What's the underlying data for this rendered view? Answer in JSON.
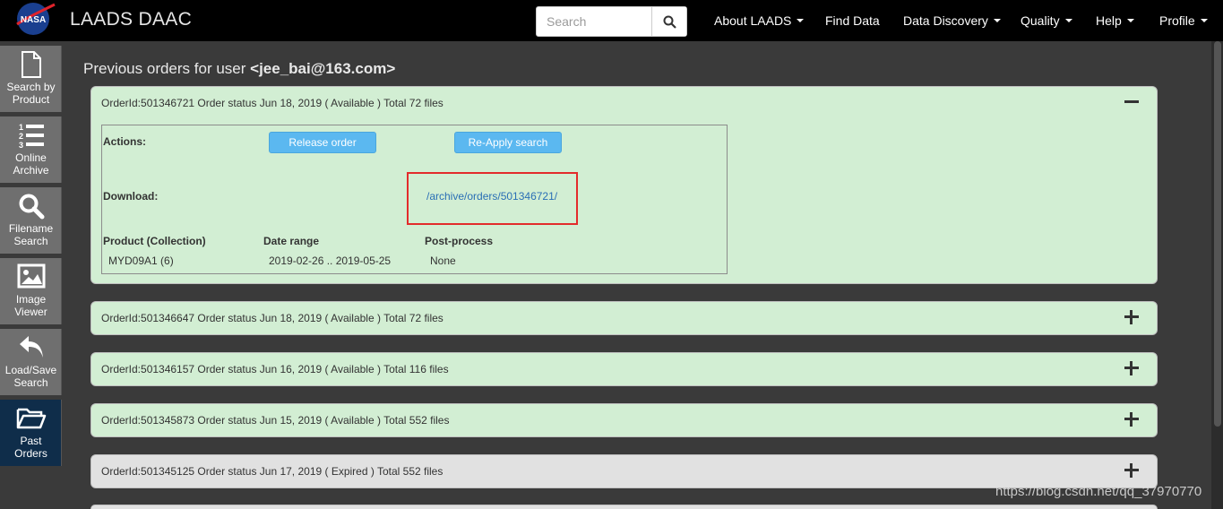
{
  "header": {
    "brand": "LAADS DAAC",
    "logo_text": "NASA",
    "search_placeholder": "Search",
    "nav": [
      {
        "label": "About LAADS",
        "dropdown": true
      },
      {
        "label": "Find Data",
        "dropdown": false
      },
      {
        "label": "Data Discovery",
        "dropdown": true
      },
      {
        "label": "Quality",
        "dropdown": true
      },
      {
        "label": "Help",
        "dropdown": true
      },
      {
        "label": "Profile",
        "dropdown": true
      }
    ]
  },
  "sidebar": {
    "items": [
      {
        "line1": "Search by",
        "line2": "Product",
        "icon": "document-icon"
      },
      {
        "line1": "Online",
        "line2": "Archive",
        "icon": "numbered-list-icon"
      },
      {
        "line1": "Filename",
        "line2": "Search",
        "icon": "search-icon"
      },
      {
        "line1": "Image",
        "line2": "Viewer",
        "icon": "image-icon"
      },
      {
        "line1": "Load/Save",
        "line2": "Search",
        "icon": "reply-arrow-icon"
      },
      {
        "line1": "Past",
        "line2": "Orders",
        "icon": "folder-open-icon",
        "active": true
      }
    ]
  },
  "main": {
    "title_prefix": "Previous orders for user ",
    "user": "<jee_bai@163.com>"
  },
  "orders": [
    {
      "header": "OrderId:501346721 Order status Jun 18, 2019 ( Available ) Total 72 files",
      "expanded": true,
      "status": "Available"
    },
    {
      "header": "OrderId:501346647 Order status Jun 18, 2019 ( Available ) Total 72 files",
      "expanded": false,
      "status": "Available"
    },
    {
      "header": "OrderId:501346157 Order status Jun 16, 2019 ( Available ) Total 116 files",
      "expanded": false,
      "status": "Available"
    },
    {
      "header": "OrderId:501345873 Order status Jun 15, 2019 ( Available ) Total 552 files",
      "expanded": false,
      "status": "Available"
    },
    {
      "header": "OrderId:501345125 Order status Jun 17, 2019 ( Expired ) Total 552 files",
      "expanded": false,
      "status": "Expired"
    }
  ],
  "order_detail": {
    "actions_label": "Actions:",
    "release_button": "Release order",
    "reapply_button": "Re-Apply search",
    "download_label": "Download:",
    "download_link": "/archive/orders/501346721/",
    "columns": [
      "Product (Collection)",
      "Date range",
      "Post-process"
    ],
    "row": [
      "MYD09A1 (6)",
      "2019-02-26 .. 2019-05-25",
      "None"
    ]
  },
  "watermark": "https://blog.csdn.net/qq_37970770",
  "colors": {
    "available_panel": "#d2eed3",
    "expired_panel": "#e1e1e1",
    "button_blue": "#5bb8f0",
    "highlight_red": "#e32b2b",
    "active_sidebar": "#0f2d4a"
  }
}
